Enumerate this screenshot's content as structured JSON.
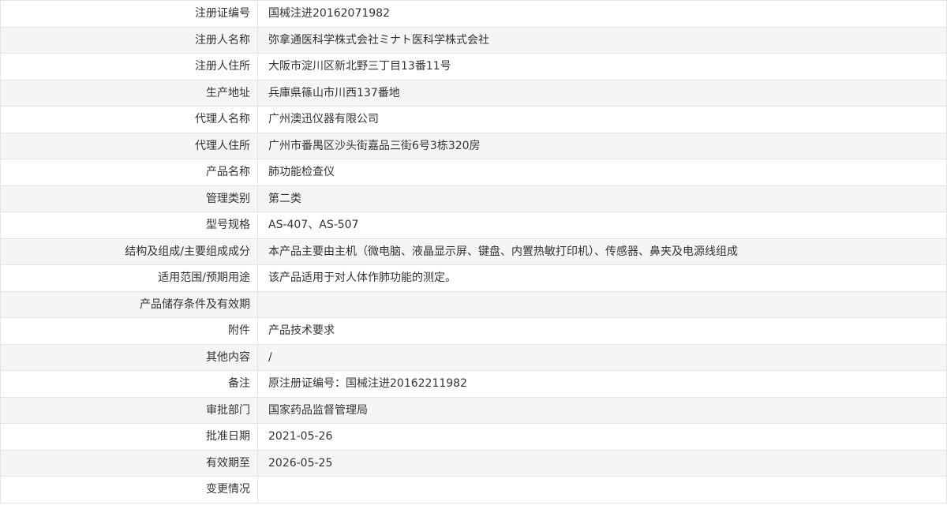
{
  "record": {
    "rows": [
      {
        "label": "注册证编号",
        "value": "国械注进20162071982"
      },
      {
        "label": "注册人名称",
        "value": "弥拿通医科学株式会社ミナト医科学株式会社"
      },
      {
        "label": "注册人住所",
        "value": "大阪市淀川区新北野三丁目13番11号"
      },
      {
        "label": "生产地址",
        "value": "兵庫県篠山市川西137番地"
      },
      {
        "label": "代理人名称",
        "value": "广州澳迅仪器有限公司"
      },
      {
        "label": "代理人住所",
        "value": "广州市番禺区沙头街嘉品三街6号3栋320房"
      },
      {
        "label": "产品名称",
        "value": "肺功能检查仪"
      },
      {
        "label": "管理类别",
        "value": "第二类"
      },
      {
        "label": "型号规格",
        "value": "AS-407、AS-507"
      },
      {
        "label": "结构及组成/主要组成成分",
        "value": "本产品主要由主机（微电脑、液晶显示屏、键盘、内置热敏打印机）、传感器、鼻夹及电源线组成"
      },
      {
        "label": "适用范围/预期用途",
        "value": "该产品适用于对人体作肺功能的测定。"
      },
      {
        "label": "产品储存条件及有效期",
        "value": ""
      },
      {
        "label": "附件",
        "value": "产品技术要求"
      },
      {
        "label": "其他内容",
        "value": "/"
      },
      {
        "label": "备注",
        "value": "原注册证编号：国械注进20162211982"
      },
      {
        "label": "审批部门",
        "value": "国家药品监督管理局"
      },
      {
        "label": "批准日期",
        "value": "2021-05-26"
      },
      {
        "label": "有效期至",
        "value": "2026-05-25"
      },
      {
        "label": "变更情况",
        "value": ""
      }
    ]
  }
}
